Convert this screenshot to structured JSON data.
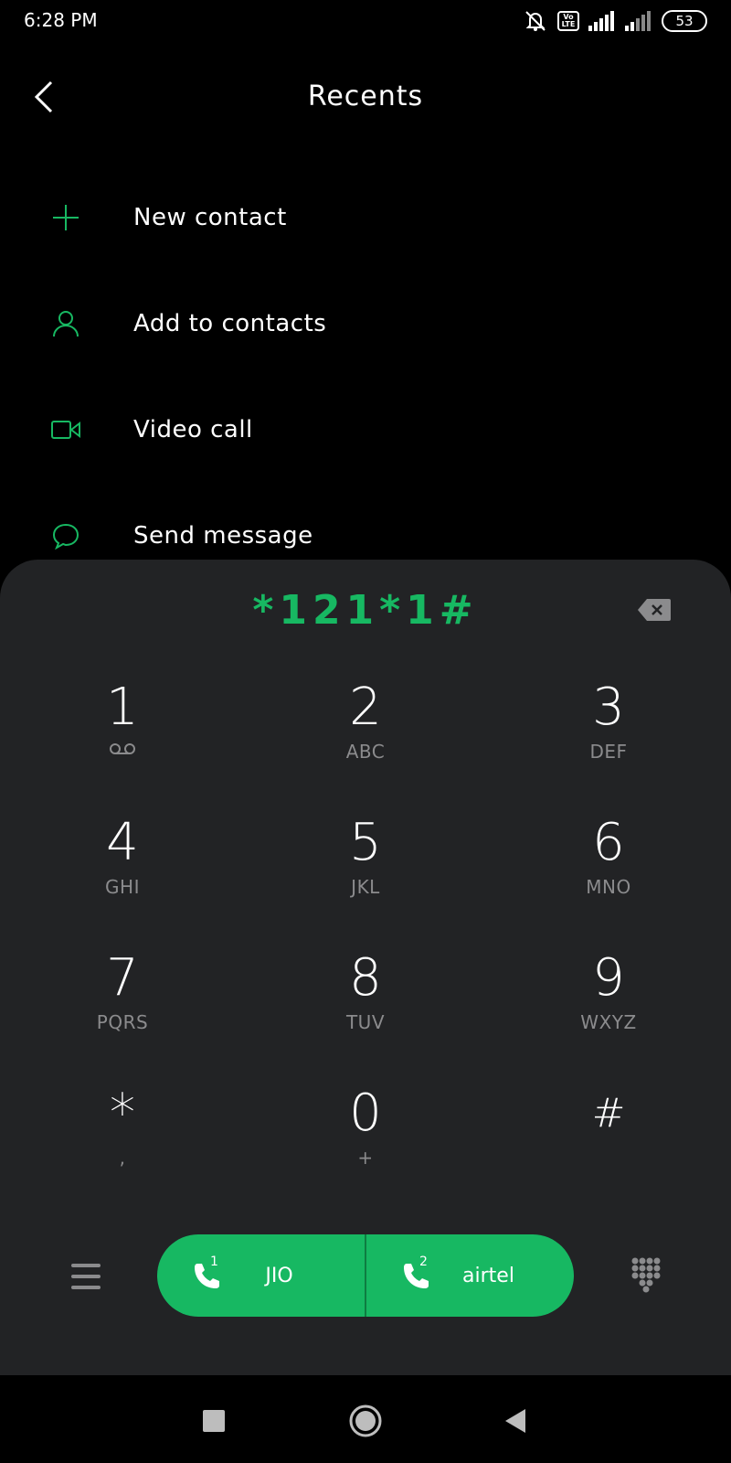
{
  "status_bar": {
    "time": "6:28 PM",
    "volte_label": "Vo LTE",
    "battery_level": "53",
    "icons": [
      "mute-icon",
      "volte-icon",
      "signal-icon",
      "signal-icon",
      "battery-icon"
    ]
  },
  "header": {
    "title": "Recents",
    "back_icon": "chevron-left-icon"
  },
  "actions": [
    {
      "label": "New contact",
      "icon": "plus-icon"
    },
    {
      "label": "Add to contacts",
      "icon": "person-icon"
    },
    {
      "label": "Video call",
      "icon": "video-icon"
    },
    {
      "label": "Send message",
      "icon": "chat-bubble-icon"
    }
  ],
  "dialer": {
    "number": "*121*1#",
    "keys": [
      {
        "digit": "1",
        "letters": ""
      },
      {
        "digit": "2",
        "letters": "ABC"
      },
      {
        "digit": "3",
        "letters": "DEF"
      },
      {
        "digit": "4",
        "letters": "GHI"
      },
      {
        "digit": "5",
        "letters": "JKL"
      },
      {
        "digit": "6",
        "letters": "MNO"
      },
      {
        "digit": "7",
        "letters": "PQRS"
      },
      {
        "digit": "8",
        "letters": "TUV"
      },
      {
        "digit": "9",
        "letters": "WXYZ"
      },
      {
        "digit": "*",
        "letters": ","
      },
      {
        "digit": "0",
        "letters": "+"
      },
      {
        "digit": "#",
        "letters": ""
      }
    ],
    "sim1": {
      "slot": "1",
      "label": "JIO"
    },
    "sim2": {
      "slot": "2",
      "label": "airtel"
    }
  },
  "colors": {
    "accent": "#17b862",
    "sheet": "#222325",
    "background": "#000000",
    "secondary_text": "#8b8b8d"
  }
}
